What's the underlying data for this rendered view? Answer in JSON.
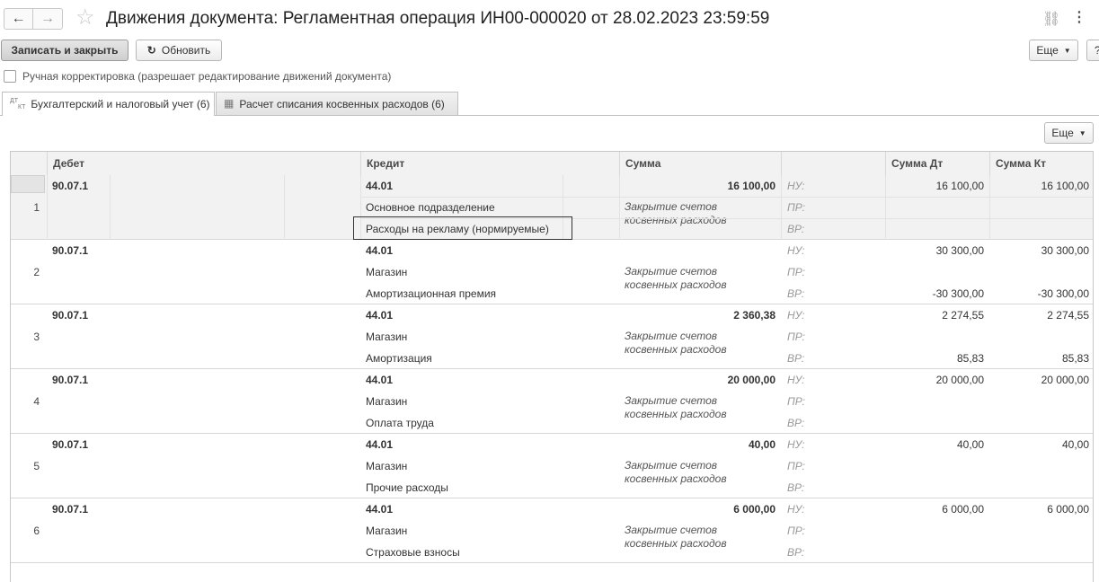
{
  "window": {
    "title": "Движения документа: Регламентная операция ИН00-000020 от 28.02.2023 23:59:59",
    "back_icon": "←",
    "forward_icon": "→",
    "star_icon": "☆",
    "link_icon": "⛓",
    "menu_icon": "⋮"
  },
  "toolbar": {
    "save_close": "Записать и закрыть",
    "refresh": "Обновить",
    "refresh_icon": "↻",
    "more": "Еще",
    "help": "?"
  },
  "manual_edit": {
    "checked": false,
    "label": "Ручная корректировка (разрешает редактирование движений документа)"
  },
  "tabs": [
    {
      "label": "Бухгалтерский и налоговый учет (6)",
      "icon": "ДТ/КТ",
      "active": true
    },
    {
      "label": "Расчет списания косвенных расходов (6)",
      "icon": "▦",
      "active": false
    }
  ],
  "table_toolbar": {
    "more": "Еще"
  },
  "table": {
    "headers": {
      "debit": "Дебет",
      "credit": "Кредит",
      "sum": "Сумма",
      "sum_dt": "Сумма Дт",
      "sum_kt": "Сумма Кт"
    },
    "rows": [
      {
        "n": "1",
        "debit": "90.07.1",
        "credit": "44.01",
        "credit_sub1": "Основное подразделение",
        "credit_sub2": "Расходы на рекламу (нормируемые)",
        "sum": "16 100,00",
        "content": "Закрытие счетов\nкосвенных расходов",
        "nu": "НУ:",
        "pr": "ПР:",
        "vr": "ВР:",
        "dt_nu": "16 100,00",
        "kt_nu": "16 100,00",
        "dt_vr": "",
        "kt_vr": ""
      },
      {
        "n": "2",
        "debit": "90.07.1",
        "credit": "44.01",
        "credit_sub1": "Магазин",
        "credit_sub2": "Амортизационная премия",
        "sum": "",
        "content": "Закрытие счетов\nкосвенных расходов",
        "nu": "НУ:",
        "pr": "ПР:",
        "vr": "ВР:",
        "dt_nu": "30 300,00",
        "kt_nu": "30 300,00",
        "dt_vr": "-30 300,00",
        "kt_vr": "-30 300,00"
      },
      {
        "n": "3",
        "debit": "90.07.1",
        "credit": "44.01",
        "credit_sub1": "Магазин",
        "credit_sub2": "Амортизация",
        "sum": "2 360,38",
        "content": "Закрытие счетов\nкосвенных расходов",
        "nu": "НУ:",
        "pr": "ПР:",
        "vr": "ВР:",
        "dt_nu": "2 274,55",
        "kt_nu": "2 274,55",
        "dt_vr": "85,83",
        "kt_vr": "85,83"
      },
      {
        "n": "4",
        "debit": "90.07.1",
        "credit": "44.01",
        "credit_sub1": "Магазин",
        "credit_sub2": "Оплата труда",
        "sum": "20 000,00",
        "content": "Закрытие счетов\nкосвенных расходов",
        "nu": "НУ:",
        "pr": "ПР:",
        "vr": "ВР:",
        "dt_nu": "20 000,00",
        "kt_nu": "20 000,00",
        "dt_vr": "",
        "kt_vr": ""
      },
      {
        "n": "5",
        "debit": "90.07.1",
        "credit": "44.01",
        "credit_sub1": "Магазин",
        "credit_sub2": "Прочие расходы",
        "sum": "40,00",
        "content": "Закрытие счетов\nкосвенных расходов",
        "nu": "НУ:",
        "pr": "ПР:",
        "vr": "ВР:",
        "dt_nu": "40,00",
        "kt_nu": "40,00",
        "dt_vr": "",
        "kt_vr": ""
      },
      {
        "n": "6",
        "debit": "90.07.1",
        "credit": "44.01",
        "credit_sub1": "Магазин",
        "credit_sub2": "Страховые взносы",
        "sum": "6 000,00",
        "content": "Закрытие счетов\nкосвенных расходов",
        "nu": "НУ:",
        "pr": "ПР:",
        "vr": "ВР:",
        "dt_nu": "6 000,00",
        "kt_nu": "6 000,00",
        "dt_vr": "",
        "kt_vr": ""
      }
    ]
  }
}
